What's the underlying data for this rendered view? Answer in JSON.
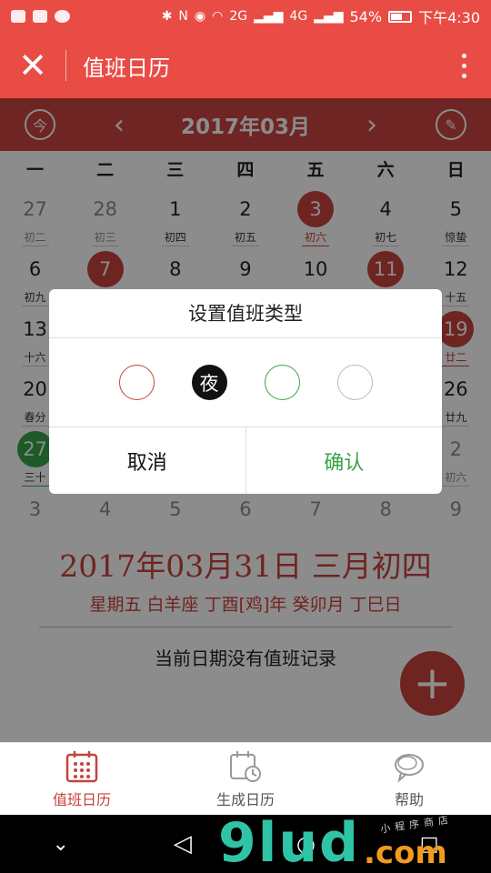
{
  "status_bar": {
    "network_labels": [
      "2G",
      "4G"
    ],
    "battery": "54%",
    "time": "下午4:30"
  },
  "app_bar": {
    "title": "值班日历"
  },
  "month_nav": {
    "month": "2017年03月",
    "today_icon_text": "今"
  },
  "weekdays": [
    "一",
    "二",
    "三",
    "四",
    "五",
    "六",
    "日"
  ],
  "weeks": [
    [
      {
        "num": "27",
        "lunar": "初二",
        "other": true
      },
      {
        "num": "28",
        "lunar": "初三",
        "other": true
      },
      {
        "num": "1",
        "lunar": "初四"
      },
      {
        "num": "2",
        "lunar": "初五"
      },
      {
        "num": "3",
        "lunar": "初六",
        "style": "red"
      },
      {
        "num": "4",
        "lunar": "初七"
      },
      {
        "num": "5",
        "lunar": "惊蛰"
      }
    ],
    [
      {
        "num": "6",
        "lunar": "初九"
      },
      {
        "num": "7",
        "lunar": "",
        "style": "red"
      },
      {
        "num": "8",
        "lunar": ""
      },
      {
        "num": "9",
        "lunar": ""
      },
      {
        "num": "10",
        "lunar": ""
      },
      {
        "num": "11",
        "lunar": "",
        "style": "red"
      },
      {
        "num": "12",
        "lunar": "十五"
      }
    ],
    [
      {
        "num": "13",
        "lunar": "十六"
      },
      {
        "num": "",
        "lunar": ""
      },
      {
        "num": "",
        "lunar": ""
      },
      {
        "num": "",
        "lunar": ""
      },
      {
        "num": "",
        "lunar": ""
      },
      {
        "num": "",
        "lunar": ""
      },
      {
        "num": "19",
        "lunar": "廿二",
        "style": "red"
      }
    ],
    [
      {
        "num": "20",
        "lunar": "春分"
      },
      {
        "num": "",
        "lunar": ""
      },
      {
        "num": "",
        "lunar": ""
      },
      {
        "num": "",
        "lunar": ""
      },
      {
        "num": "",
        "lunar": ""
      },
      {
        "num": "",
        "lunar": ""
      },
      {
        "num": "26",
        "lunar": "廿九"
      }
    ],
    [
      {
        "num": "27",
        "lunar": "三十",
        "style": "green"
      },
      {
        "num": "",
        "lunar": ""
      },
      {
        "num": "",
        "lunar": ""
      },
      {
        "num": "",
        "lunar": ""
      },
      {
        "num": "",
        "lunar": ""
      },
      {
        "num": "",
        "lunar": ""
      },
      {
        "num": "2",
        "lunar": "初六",
        "other": true
      }
    ],
    [
      {
        "num": "3",
        "lunar": "",
        "other": true
      },
      {
        "num": "4",
        "lunar": "",
        "other": true
      },
      {
        "num": "5",
        "lunar": "",
        "other": true
      },
      {
        "num": "6",
        "lunar": "",
        "other": true
      },
      {
        "num": "7",
        "lunar": "",
        "other": true
      },
      {
        "num": "8",
        "lunar": "",
        "other": true
      },
      {
        "num": "9",
        "lunar": "",
        "other": true
      }
    ]
  ],
  "selected": {
    "date": "2017年03月31日 三月初四",
    "detail": "星期五 白羊座 丁酉[鸡]年 癸卯月 丁巳日",
    "empty_message": "当前日期没有值班记录"
  },
  "modal": {
    "title": "设置值班类型",
    "types": [
      {
        "label": "",
        "style": "red"
      },
      {
        "label": "夜",
        "style": "black"
      },
      {
        "label": "",
        "style": "green"
      },
      {
        "label": "",
        "style": "gray"
      }
    ],
    "cancel": "取消",
    "confirm": "确认"
  },
  "bottom_nav": [
    {
      "label": "值班日历",
      "active": true
    },
    {
      "label": "生成日历",
      "active": false
    },
    {
      "label": "帮助",
      "active": false
    }
  ],
  "watermark": {
    "main": "9lud",
    "suffix": ".com",
    "tagline": "小程序商店"
  },
  "colors": {
    "primary": "#e94c45",
    "dark_primary": "#c94440",
    "accent_red": "#c8423d",
    "accent_green": "#3aa24a"
  }
}
